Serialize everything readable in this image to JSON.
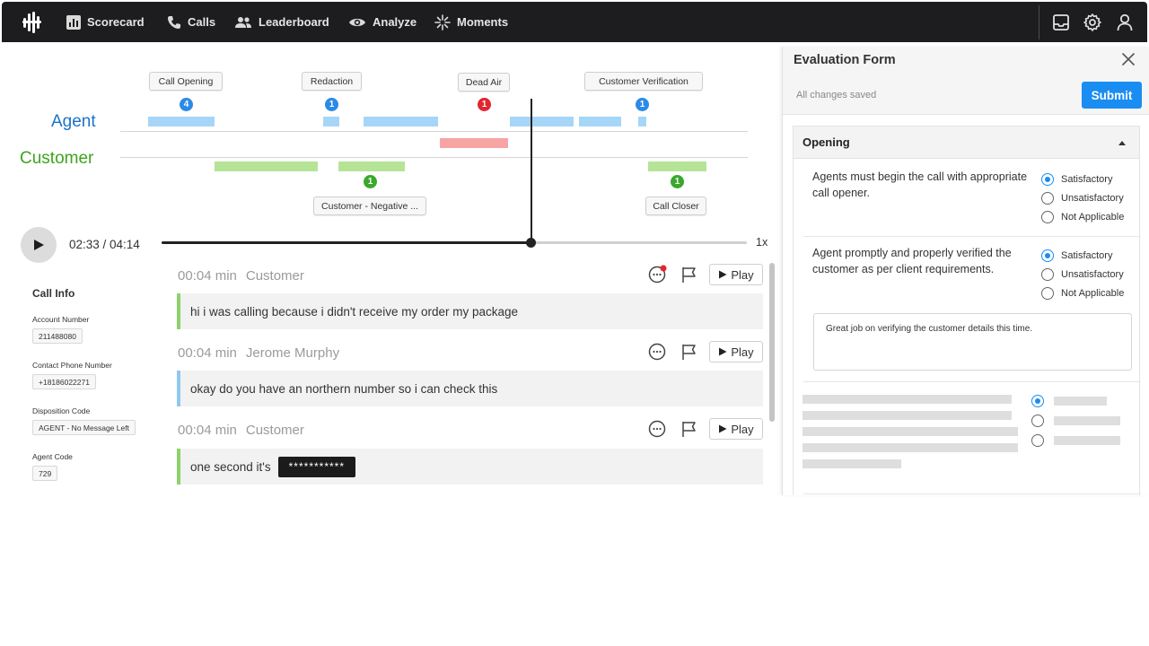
{
  "nav": {
    "items": [
      {
        "label": "Scorecard",
        "icon": "bar-chart-icon"
      },
      {
        "label": "Calls",
        "icon": "phone-icon"
      },
      {
        "label": "Leaderboard",
        "icon": "people-icon"
      },
      {
        "label": "Analyze",
        "icon": "eye-icon"
      },
      {
        "label": "Moments",
        "icon": "sparkle-icon"
      }
    ],
    "right_icons": [
      "inbox-icon",
      "gear-icon",
      "user-icon"
    ]
  },
  "timeline": {
    "agent_label": "Agent",
    "customer_label": "Customer",
    "colors": {
      "agent": "#1b73c9",
      "customer": "#3da31f",
      "agent_segment": "#a6d6f7",
      "customer_segment": "#b5e497",
      "dead_air_segment": "#f7a4a4",
      "badge_blue": "#2b8ae6",
      "badge_red": "#e0262f",
      "badge_green": "#3ba82d"
    },
    "markers": [
      {
        "label": "Call Opening",
        "count": "4",
        "color": "blue"
      },
      {
        "label": "Redaction",
        "count": "1",
        "color": "blue"
      },
      {
        "label": "Dead Air",
        "count": "1",
        "color": "red"
      },
      {
        "label": "Customer Verification",
        "count": "1",
        "color": "blue"
      },
      {
        "label": "Customer - Negative ...",
        "count": "1",
        "color": "green"
      },
      {
        "label": "Call Closer",
        "count": "1",
        "color": "green"
      }
    ]
  },
  "player": {
    "time": "02:33 / 04:14",
    "progress": 0.6,
    "speed": "1x"
  },
  "call_info": {
    "title": "Call Info",
    "fields": [
      {
        "label": "Account Number",
        "value": "211488080"
      },
      {
        "label": "Contact Phone Number",
        "value": "+18186022271"
      },
      {
        "label": "Disposition Code",
        "value": "AGENT - No Message Left"
      },
      {
        "label": "Agent Code",
        "value": "729"
      }
    ]
  },
  "transcript": {
    "play_label": "Play",
    "utterances": [
      {
        "time": "00:04 min",
        "speaker": "Customer",
        "text": "hi i was calling because i didn't receive my order my package"
      },
      {
        "time": "00:04 min",
        "speaker": "Jerome Murphy",
        "text": "okay do you have an northern number so i can check this"
      },
      {
        "time": "00:04 min",
        "speaker": "Customer",
        "text": "one second it's",
        "redacted": "***********"
      }
    ]
  },
  "evaluation": {
    "title": "Evaluation Form",
    "status": "All changes saved",
    "submit_label": "Submit",
    "section": "Opening",
    "options": [
      "Satisfactory",
      "Unsatisfactory",
      "Not Applicable"
    ],
    "questions": [
      {
        "text": "Agents must begin the call with appropriate call opener.",
        "selected": "Satisfactory"
      },
      {
        "text": "Agent promptly and properly verified the customer as per client requirements.",
        "selected": "Satisfactory"
      }
    ],
    "comment": "Great job on verifying the customer details this time."
  }
}
